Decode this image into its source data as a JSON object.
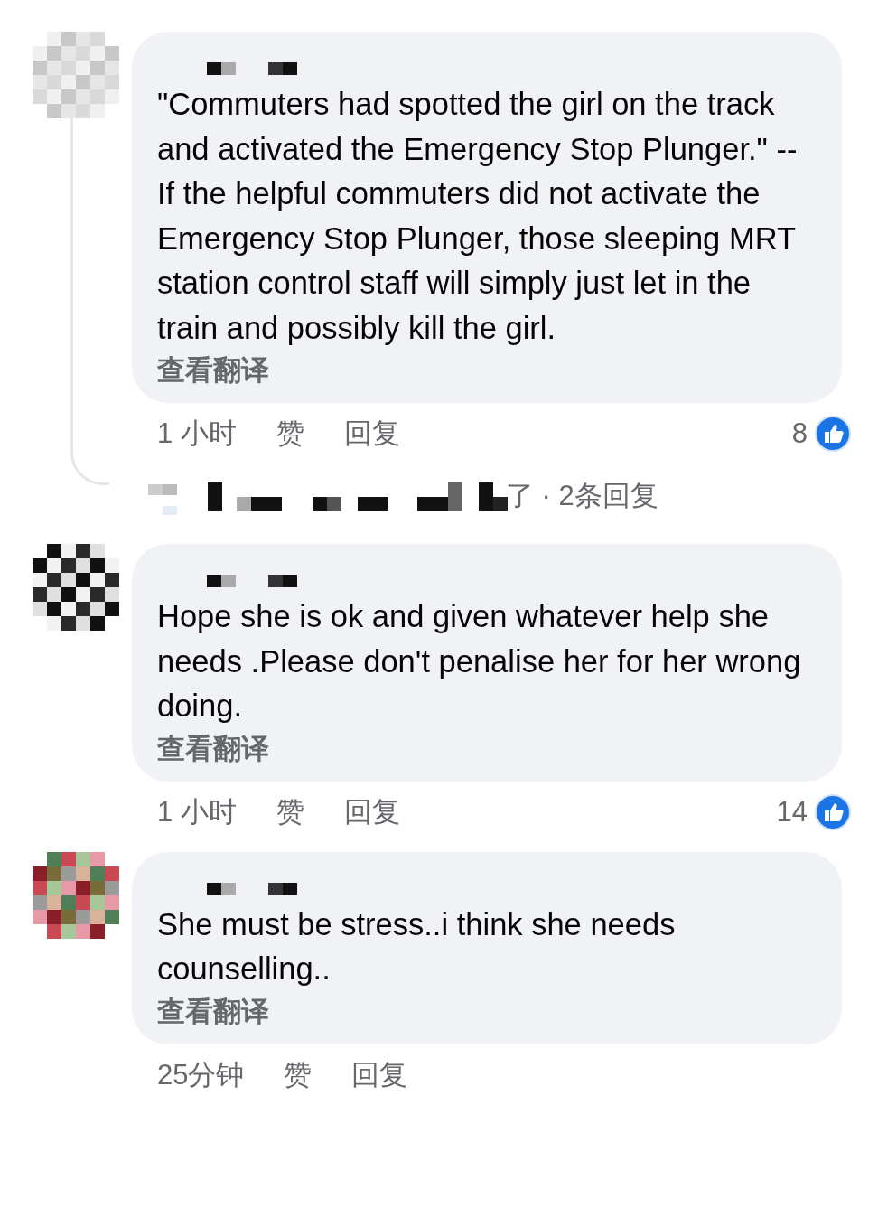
{
  "comments": [
    {
      "text": "\"Commuters had spotted the girl on the track and activated the Emergency Stop Plunger.\" -- If the helpful commuters did not activate the Emergency Stop Plunger, those sleeping MRT station control staff will simply just let in the train and possibly kill the girl.",
      "translate_link": "查看翻译",
      "time": "1 小时",
      "like_action": "赞",
      "reply_action": "回复",
      "like_count": "8",
      "replies_link": "了 · 2条回复"
    },
    {
      "text": "Hope she is ok and given whatever help she needs .Please don't penalise her for her wrong doing.",
      "translate_link": "查看翻译",
      "time": "1 小时",
      "like_action": "赞",
      "reply_action": "回复",
      "like_count": "14"
    },
    {
      "text": "She must be stress..i think she needs counselling..",
      "translate_link": "查看翻译",
      "time": "25分钟",
      "like_action": "赞",
      "reply_action": "回复"
    }
  ]
}
